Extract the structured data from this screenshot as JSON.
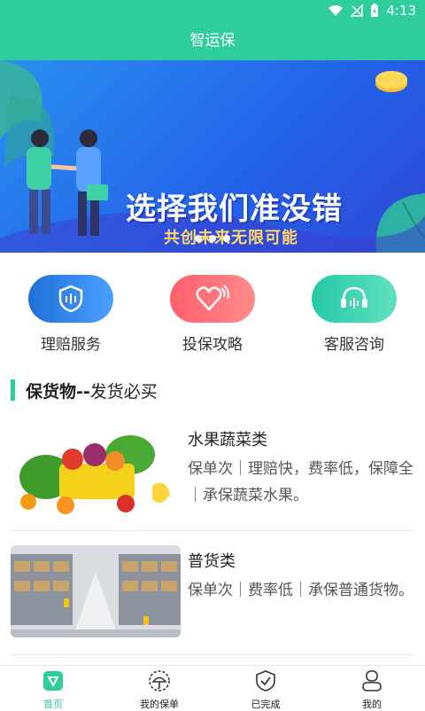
{
  "status": {
    "time": "4:13"
  },
  "header": {
    "title": "智运保"
  },
  "banner": {
    "headline": "选择我们准没错",
    "subheadline": "共创未来无限可能",
    "carousel_pages": 3
  },
  "services": [
    {
      "label": "理赔服务",
      "icon": "claims-shield-icon",
      "color": "#2d7fe0"
    },
    {
      "label": "投保攻略",
      "icon": "heart-signal-icon",
      "color": "#ff6f7a"
    },
    {
      "label": "客服咨询",
      "icon": "headset-icon",
      "color": "#35d3ae"
    }
  ],
  "section": {
    "title_bold": "保货物--",
    "title_rest": "发货必买"
  },
  "products": [
    {
      "name": "水果蔬菜类",
      "desc": "保单次｜理赔快，费率低，保障全｜承保蔬菜水果。",
      "image": "fruit-basket-image"
    },
    {
      "name": "普货类",
      "desc": "保单次｜费率低｜承保普通货物。",
      "image": "warehouse-image"
    }
  ],
  "tabs": [
    {
      "label": "首页",
      "icon": "home-icon",
      "active": true
    },
    {
      "label": "我的保单",
      "icon": "policy-umbrella-icon",
      "active": false
    },
    {
      "label": "已完成",
      "icon": "completed-shield-icon",
      "active": false
    },
    {
      "label": "我的",
      "icon": "profile-icon",
      "active": false
    }
  ],
  "colors": {
    "accent": "#2fcc9e",
    "text": "#222222",
    "subtext": "#555555"
  }
}
